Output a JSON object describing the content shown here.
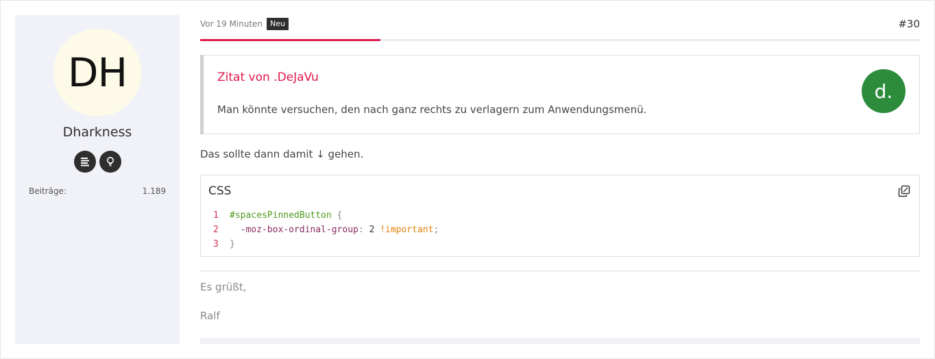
{
  "author": {
    "initials": "DH",
    "name": "Dharkness",
    "avatar_bg": "#fdfbe8",
    "badges": [
      {
        "icon": "lines-icon"
      },
      {
        "icon": "lightbulb-icon"
      }
    ],
    "stats": {
      "label": "Beiträge:",
      "value": "1.189"
    }
  },
  "post": {
    "time": "Vor 19 Minuten",
    "new_badge": "Neu",
    "number": "#30",
    "read_progress": 0.25,
    "accent_color": "#e0174a"
  },
  "quote": {
    "title": "Zitat von .DeJaVu",
    "text": "Man könnte versuchen, den nach ganz rechts zu verlagern zum Anwendungsmenü.",
    "avatar_letter": "d.",
    "avatar_color": "#2c8c3c"
  },
  "content": {
    "paragraph": "Das sollte dann damit ↓ gehen."
  },
  "code": {
    "language": "CSS",
    "lines": [
      {
        "num": "1",
        "selector": "#spacesPinnedButton",
        "open": " {"
      },
      {
        "num": "2",
        "property": "-moz-box-ordinal-group",
        "colon": ": ",
        "value": "2",
        "important": "!important",
        "semi": ";"
      },
      {
        "num": "3",
        "close": "}"
      }
    ]
  },
  "signature": {
    "line1": "Es grüßt,",
    "line2": "Ralf"
  }
}
